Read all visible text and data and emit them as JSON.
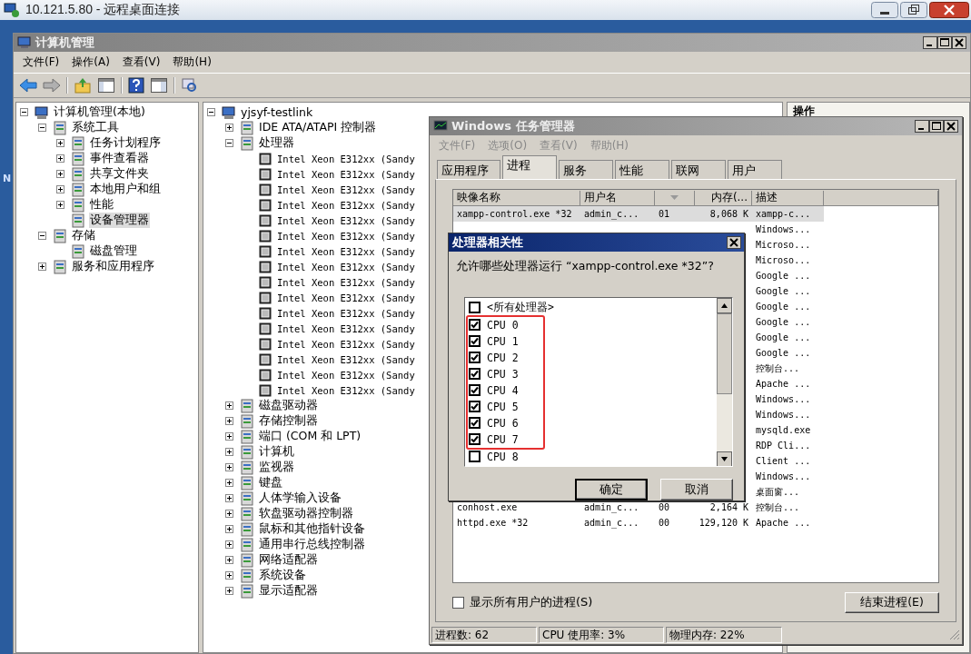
{
  "remote_window": {
    "title": "10.121.5.80 - 远程桌面连接"
  },
  "desktop": {
    "label": "N"
  },
  "mmc": {
    "title": "计算机管理",
    "menu": [
      "文件(F)",
      "操作(A)",
      "查看(V)",
      "帮助(H)"
    ],
    "nav_tree": [
      {
        "label": "计算机管理(本地)",
        "expanded": true,
        "selected": false,
        "children": [
          {
            "label": "系统工具",
            "expanded": true,
            "selected": false,
            "children": [
              {
                "label": "任务计划程序",
                "expanded": false,
                "selected": false
              },
              {
                "label": "事件查看器",
                "expanded": false,
                "selected": false
              },
              {
                "label": "共享文件夹",
                "expanded": false,
                "selected": false
              },
              {
                "label": "本地用户和组",
                "expanded": false,
                "selected": false
              },
              {
                "label": "性能",
                "expanded": false,
                "selected": false
              },
              {
                "label": "设备管理器",
                "selected": true
              }
            ]
          },
          {
            "label": "存储",
            "expanded": true,
            "selected": false,
            "children": [
              {
                "label": "磁盘管理",
                "selected": false
              }
            ]
          },
          {
            "label": "服务和应用程序",
            "expanded": false,
            "selected": false
          }
        ]
      }
    ],
    "device_tree": [
      {
        "label": "yjsyf-testlink",
        "expanded": true,
        "children": [
          {
            "label": "IDE ATA/ATAPI 控制器",
            "expanded": false
          },
          {
            "label": "处理器",
            "expanded": true,
            "children": [
              {
                "label": "Intel Xeon E312xx (Sandy"
              },
              {
                "label": "Intel Xeon E312xx (Sandy"
              },
              {
                "label": "Intel Xeon E312xx (Sandy"
              },
              {
                "label": "Intel Xeon E312xx (Sandy"
              },
              {
                "label": "Intel Xeon E312xx (Sandy"
              },
              {
                "label": "Intel Xeon E312xx (Sandy"
              },
              {
                "label": "Intel Xeon E312xx (Sandy"
              },
              {
                "label": "Intel Xeon E312xx (Sandy"
              },
              {
                "label": "Intel Xeon E312xx (Sandy"
              },
              {
                "label": "Intel Xeon E312xx (Sandy"
              },
              {
                "label": "Intel Xeon E312xx (Sandy"
              },
              {
                "label": "Intel Xeon E312xx (Sandy"
              },
              {
                "label": "Intel Xeon E312xx (Sandy"
              },
              {
                "label": "Intel Xeon E312xx (Sandy"
              },
              {
                "label": "Intel Xeon E312xx (Sandy"
              },
              {
                "label": "Intel Xeon E312xx (Sandy"
              }
            ]
          },
          {
            "label": "磁盘驱动器",
            "expanded": false
          },
          {
            "label": "存储控制器",
            "expanded": false
          },
          {
            "label": "端口 (COM 和 LPT)",
            "expanded": false
          },
          {
            "label": "计算机",
            "expanded": false
          },
          {
            "label": "监视器",
            "expanded": false
          },
          {
            "label": "键盘",
            "expanded": false
          },
          {
            "label": "人体学输入设备",
            "expanded": false
          },
          {
            "label": "软盘驱动器控制器",
            "expanded": false
          },
          {
            "label": "鼠标和其他指针设备",
            "expanded": false
          },
          {
            "label": "通用串行总线控制器",
            "expanded": false
          },
          {
            "label": "网络适配器",
            "expanded": false
          },
          {
            "label": "系统设备",
            "expanded": false
          },
          {
            "label": "显示适配器",
            "expanded": false
          }
        ]
      }
    ],
    "actions_pane": {
      "title": "操作"
    }
  },
  "task_manager": {
    "title": "Windows 任务管理器",
    "menu": [
      "文件(F)",
      "选项(O)",
      "查看(V)",
      "帮助(H)"
    ],
    "tabs": [
      {
        "label": "应用程序",
        "selected": false
      },
      {
        "label": "进程",
        "selected": true
      },
      {
        "label": "服务",
        "selected": false
      },
      {
        "label": "性能",
        "selected": false
      },
      {
        "label": "联网",
        "selected": false
      },
      {
        "label": "用户",
        "selected": false
      }
    ],
    "columns": [
      "映像名称",
      "用户名",
      "",
      "内存(...",
      "描述"
    ],
    "rows": [
      {
        "image": "xampp-control.exe *32",
        "user": "admin_c...",
        "cpu": "01",
        "memory": "8,068 K",
        "description": "xampp-c...",
        "selected": true
      },
      {
        "description": "Windows...",
        "selected": false
      },
      {
        "description": "Microso...",
        "selected": false
      },
      {
        "description": "Microso...",
        "selected": false
      },
      {
        "description": "Google ...",
        "selected": false
      },
      {
        "description": "Google ...",
        "selected": false
      },
      {
        "description": "Google ...",
        "selected": false
      },
      {
        "description": "Google ...",
        "selected": false
      },
      {
        "description": "Google ...",
        "selected": false
      },
      {
        "description": "Google ...",
        "selected": false
      },
      {
        "description": "控制台...",
        "selected": false
      },
      {
        "description": "Apache ...",
        "selected": false
      },
      {
        "description": "Windows...",
        "selected": false
      },
      {
        "description": "Windows...",
        "selected": false
      },
      {
        "description": "mysqld.exe",
        "selected": false
      },
      {
        "description": "RDP Cli...",
        "selected": false
      },
      {
        "description": "Client ...",
        "selected": false
      },
      {
        "description": "Windows...",
        "selected": false
      },
      {
        "description": "桌面窗...",
        "selected": false
      },
      {
        "image": "conhost.exe",
        "user": "admin_c...",
        "cpu": "00",
        "memory": "2,164 K",
        "description": "控制台...",
        "selected": false
      },
      {
        "image": "httpd.exe *32",
        "user": "admin_c...",
        "cpu": "00",
        "memory": "129,120 K",
        "description": "Apache ...",
        "selected": false
      }
    ],
    "show_all_users": {
      "label": "显示所有用户的进程(S)",
      "checked": false
    },
    "end_button": "结束进程(E)",
    "status": [
      "进程数: 62",
      "CPU 使用率: 3%",
      "物理内存: 22%"
    ]
  },
  "affinity_dialog": {
    "title": "处理器相关性",
    "prompt": "允许哪些处理器运行 “xampp-control.exe *32”?",
    "items": [
      {
        "kind": "checkbox",
        "label": "<所有处理器>",
        "checked": false
      },
      {
        "kind": "highlight",
        "items": [
          {
            "label": "CPU 0",
            "checked": true
          },
          {
            "label": "CPU 1",
            "checked": true
          },
          {
            "label": "CPU 2",
            "checked": true
          },
          {
            "label": "CPU 3",
            "checked": true
          },
          {
            "label": "CPU 4",
            "checked": true
          },
          {
            "label": "CPU 5",
            "checked": true
          },
          {
            "label": "CPU 6",
            "checked": true
          },
          {
            "label": "CPU 7",
            "checked": true
          }
        ]
      },
      {
        "kind": "checkbox",
        "label": "CPU 8",
        "checked": false
      }
    ],
    "buttons": [
      {
        "label": "确定",
        "default": true
      },
      {
        "label": "取消",
        "default": false
      }
    ]
  }
}
